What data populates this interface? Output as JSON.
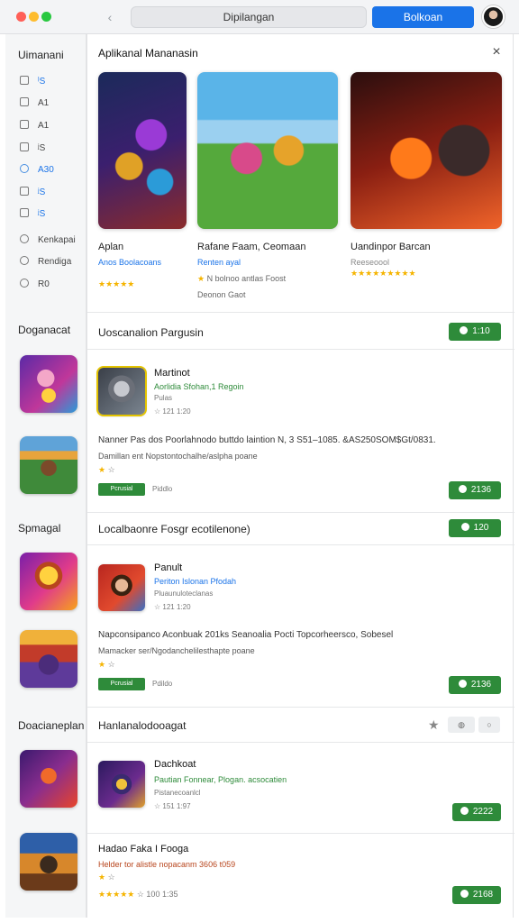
{
  "titlebar": {
    "address": "Dipilangan",
    "primary_button": "Bolkoan"
  },
  "sidebar": {
    "title": "Uimanani",
    "items": [
      {
        "label": "ˡS"
      },
      {
        "label": "A1"
      },
      {
        "label": "A1"
      },
      {
        "label": "ʲS"
      },
      {
        "label": "A30"
      },
      {
        "label": "ʲS"
      },
      {
        "label": "ʲS"
      },
      {
        "label": "Kenkapai"
      },
      {
        "label": "Rendiga"
      },
      {
        "label": "R0"
      }
    ],
    "sections": [
      "Doganacat",
      "Spmagal",
      "Doacianeplan"
    ]
  },
  "main": {
    "title": "Aplikanal Mananasin",
    "close_label": "×",
    "featured": [
      {
        "title": "Aplan",
        "subtitle": "Anos Boolacoans",
        "rating_stars": "★★★★★",
        "rating_text": ""
      },
      {
        "title": "Rafane Faam, Ceomaan",
        "subtitle": "Renten ayal",
        "rating_stars": "★",
        "rating_text": "N bolnoo antlas Foost",
        "extra": "Deonon Gaot"
      },
      {
        "title": "Uandinpor Barcan",
        "subtitle": "Reeseoool",
        "rating_stars": "★★★★★★★★★",
        "rating_text": ""
      }
    ],
    "section1": {
      "title": "Uoscanalion Pargusin",
      "button": "1:10",
      "app": {
        "name": "Martinot",
        "developer": "Aorlidia Sfohan,1 Regoin",
        "category": "Pulas",
        "meta": "☆ 121   1:20"
      },
      "description": "Nanner Pas dos Poorlahnodo buttdo laintion N, 3 S51–1085. &AS250SOM$Gt/0831.",
      "description2": "Damillan ent Nopstontochalhe/aslpha poane",
      "tag": "Pcrusial",
      "tag2": "Piddlo",
      "buy": "2136"
    },
    "section2": {
      "title": "Localbaonre Fosgr ecotilenone)",
      "button": "120",
      "app": {
        "name": "Panult",
        "developer": "Periton Islonan Pfodah",
        "category": "Pluaunuloteclanas",
        "meta": "☆ 121   1:20"
      },
      "description": "Napconsipanco Aconbuak 201ks Seanoalia Pocti Topcorheersco, Sobesel",
      "description2": "Mamacker ser/Ngodanchelilesthapte poane",
      "tag": "Pcrusial",
      "tag2": "Pdildo",
      "buy": "2136"
    },
    "section3": {
      "title": "Hanlanalodooagat",
      "apps": [
        {
          "name": "Dachkoat",
          "developer": "Pautian Fonnear, Plogan. acsocatien",
          "category": "Pistanecoanlcl",
          "meta": "☆ 151   1:97",
          "buy": "2222"
        },
        {
          "name": "Hadao Faka I Fooga",
          "developer": "Helder tor alistle nopacanm 3606 t059",
          "category": "",
          "meta": "☆ 100   1:35",
          "buy": "2168"
        }
      ]
    }
  }
}
